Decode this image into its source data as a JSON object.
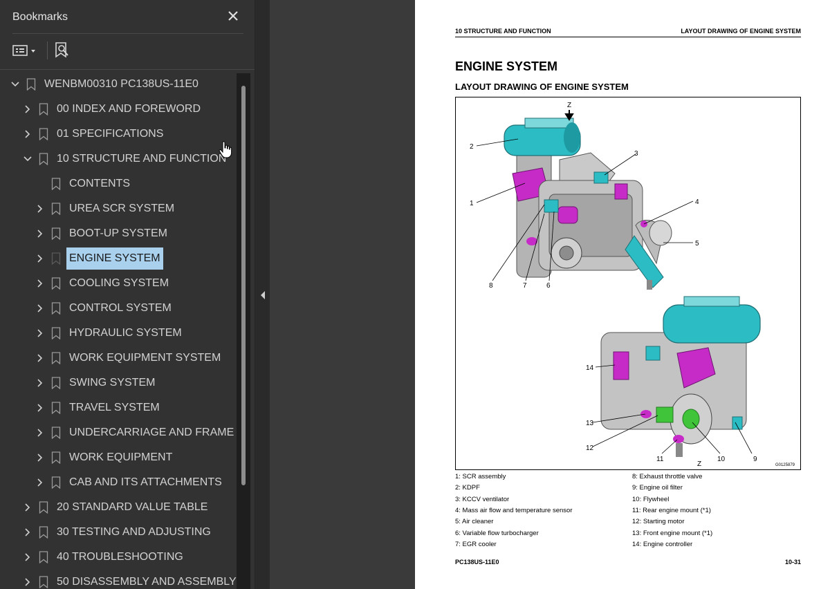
{
  "bookmarks_panel": {
    "title": "Bookmarks",
    "tree": [
      {
        "label": "WENBM00310 PC138US-11E0",
        "level": 0,
        "expanded": true
      },
      {
        "label": "00 INDEX AND FOREWORD",
        "level": 1,
        "expanded": false
      },
      {
        "label": "01 SPECIFICATIONS",
        "level": 1,
        "expanded": false
      },
      {
        "label": "10 STRUCTURE AND FUNCTION",
        "level": 1,
        "expanded": true
      },
      {
        "label": "CONTENTS",
        "level": 2,
        "leaf": true
      },
      {
        "label": "UREA SCR SYSTEM",
        "level": 2,
        "expanded": false
      },
      {
        "label": "BOOT-UP SYSTEM",
        "level": 2,
        "expanded": false
      },
      {
        "label": "ENGINE SYSTEM",
        "level": 2,
        "expanded": false,
        "selected": true
      },
      {
        "label": "COOLING SYSTEM",
        "level": 2,
        "expanded": false
      },
      {
        "label": "CONTROL SYSTEM",
        "level": 2,
        "expanded": false
      },
      {
        "label": "HYDRAULIC SYSTEM",
        "level": 2,
        "expanded": false
      },
      {
        "label": "WORK EQUIPMENT SYSTEM",
        "level": 2,
        "expanded": false
      },
      {
        "label": "SWING SYSTEM",
        "level": 2,
        "expanded": false
      },
      {
        "label": "TRAVEL SYSTEM",
        "level": 2,
        "expanded": false
      },
      {
        "label": "UNDERCARRIAGE AND FRAME",
        "level": 2,
        "expanded": false
      },
      {
        "label": "WORK EQUIPMENT",
        "level": 2,
        "expanded": false
      },
      {
        "label": "CAB AND ITS ATTACHMENTS",
        "level": 2,
        "expanded": false
      },
      {
        "label": "20 STANDARD VALUE TABLE",
        "level": 1,
        "expanded": false
      },
      {
        "label": "30 TESTING AND ADJUSTING",
        "level": 1,
        "expanded": false
      },
      {
        "label": "40 TROUBLESHOOTING",
        "level": 1,
        "expanded": false
      },
      {
        "label": "50 DISASSEMBLY AND ASSEMBLY",
        "level": 1,
        "expanded": false
      }
    ],
    "icons": {
      "close": "close-icon",
      "options": "bookmark-options-icon",
      "find": "find-bookmark-icon",
      "bookmark": "bookmark-icon"
    }
  },
  "document_page": {
    "header_left": "10 STRUCTURE AND FUNCTION",
    "header_right": "LAYOUT DRAWING OF ENGINE SYSTEM",
    "title": "ENGINE SYSTEM",
    "subtitle": "LAYOUT DRAWING OF ENGINE SYSTEM",
    "figure_code": "G0125879",
    "view_label": "Z",
    "callouts": [
      "1",
      "2",
      "3",
      "4",
      "5",
      "6",
      "7",
      "8",
      "9",
      "10",
      "11",
      "12",
      "13",
      "14"
    ],
    "legend_left": [
      "1: SCR assembly",
      "2: KDPF",
      "3: KCCV ventilator",
      "4: Mass air flow and temperature sensor",
      "5: Air cleaner",
      "6: Variable flow turbocharger",
      "7: EGR cooler"
    ],
    "legend_right": [
      "8: Exhaust throttle valve",
      "9: Engine oil filter",
      "10: Flywheel",
      "11: Rear engine mount (*1)",
      "12: Starting motor",
      "13: Front engine mount (*1)",
      "14: Engine controller"
    ],
    "footer_left": "PC138US-11E0",
    "footer_right": "10-31"
  },
  "colors": {
    "selection": "#a9d0ec",
    "panel_bg": "#323232",
    "cyan_part": "#2bbcc4",
    "magenta_part": "#c62bc8",
    "green_part": "#3fc43a"
  }
}
